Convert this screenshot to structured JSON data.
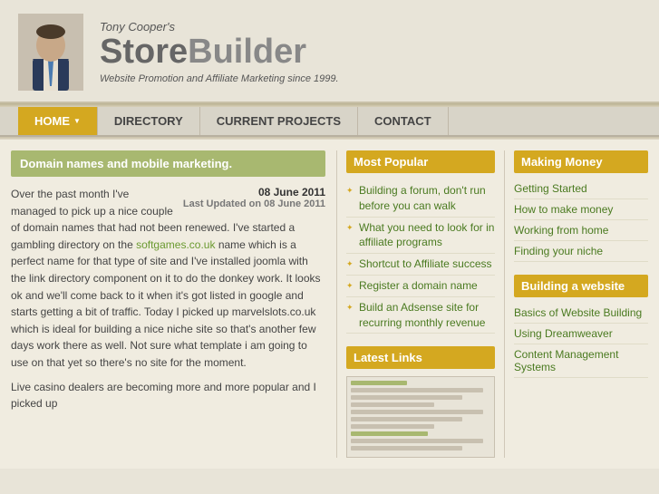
{
  "header": {
    "name": "Tony Cooper's",
    "brand_part1": "Store",
    "brand_part2": "Builder",
    "tagline": "Website Promotion and Affiliate Marketing since 1999."
  },
  "nav": {
    "items": [
      {
        "label": "HOME",
        "active": true
      },
      {
        "label": "DIRECTORY",
        "active": false
      },
      {
        "label": "CURRENT PROJECTS",
        "active": false
      },
      {
        "label": "CONTACT",
        "active": false
      }
    ]
  },
  "article": {
    "title": "Domain names and mobile marketing.",
    "date": "08 June 2011",
    "last_updated": "Last Updated on 08 June 2011",
    "body1": "Over the past month I've managed to pick up a nice couple of domain names that had not been renewed. I've started a gambling directory on the",
    "link_text": "softgames.co.uk",
    "link_url": "#",
    "body2": "name which is a perfect name for that type of site and I've installed joomla with the link directory component on it to do the donkey work. It looks ok and we'll come back to it when it's got listed in google and starts getting a bit of traffic. Today I picked up marvelslots.co.uk which is ideal for building a nice niche site so that's another few days work there as well. Not sure what template i am going to use on that yet so there's no site for the moment.",
    "body3": "Live casino dealers are becoming more and more popular and I picked up"
  },
  "most_popular": {
    "title": "Most Popular",
    "items": [
      "Building a forum, don't run before you can walk",
      "What you need to look for in affiliate programs",
      "Shortcut to Affiliate success",
      "Register a domain name",
      "Build an Adsense site for recurring monthly revenue"
    ]
  },
  "latest_links": {
    "title": "Latest Links"
  },
  "making_money": {
    "title": "Making Money",
    "items": [
      "Getting Started",
      "How to make money",
      "Working from home",
      "Finding your niche"
    ]
  },
  "building_website": {
    "title": "Building a website",
    "items": [
      "Basics of Website Building",
      "Using Dreamweaver",
      "Content Management Systems"
    ]
  }
}
